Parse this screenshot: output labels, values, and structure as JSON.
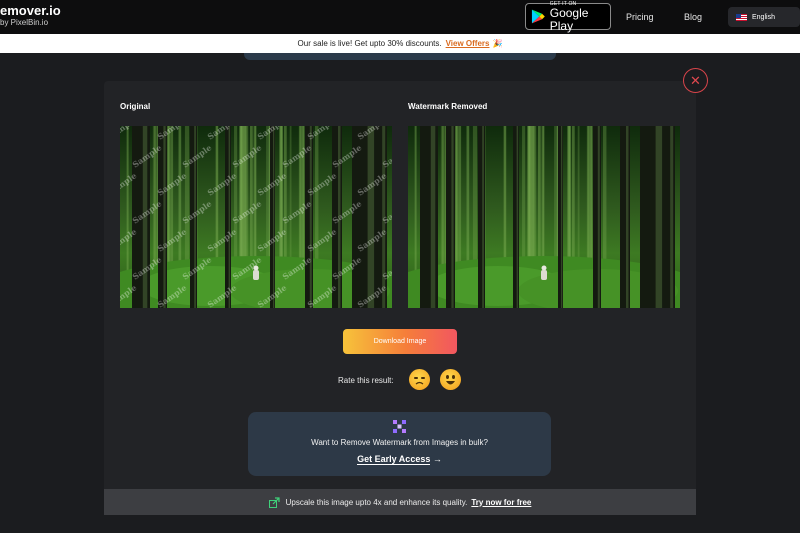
{
  "header": {
    "brand_title": "emover.io",
    "brand_sub": "by PixelBin.io",
    "store_badge": {
      "small": "GET IT ON",
      "big": "Google Play"
    },
    "nav": [
      {
        "label": "Pricing"
      },
      {
        "label": "Blog"
      }
    ],
    "language": "English"
  },
  "banner": {
    "text": "Our sale is live! Get upto 30% discounts.",
    "link": "View Offers",
    "emoji": "🎉"
  },
  "close_symbol": "✕",
  "panels": {
    "original_label": "Original",
    "removed_label": "Watermark Removed",
    "watermark_text": "Sample"
  },
  "download_label": "Download Image",
  "rating": {
    "label": "Rate this result:",
    "options": [
      "sad-emoji",
      "happy-emoji"
    ]
  },
  "bulk": {
    "text": "Want to Remove Watermark from Images in bulk?",
    "cta": "Get Early Access",
    "arrow": "→"
  },
  "upscale": {
    "text": "Upscale this image upto 4x and enhance its quality.",
    "link": "Try now for free"
  },
  "colors": {
    "accent_orange": "#f57e3a",
    "close_red": "#e0484f",
    "card_blue": "#2d3947"
  }
}
